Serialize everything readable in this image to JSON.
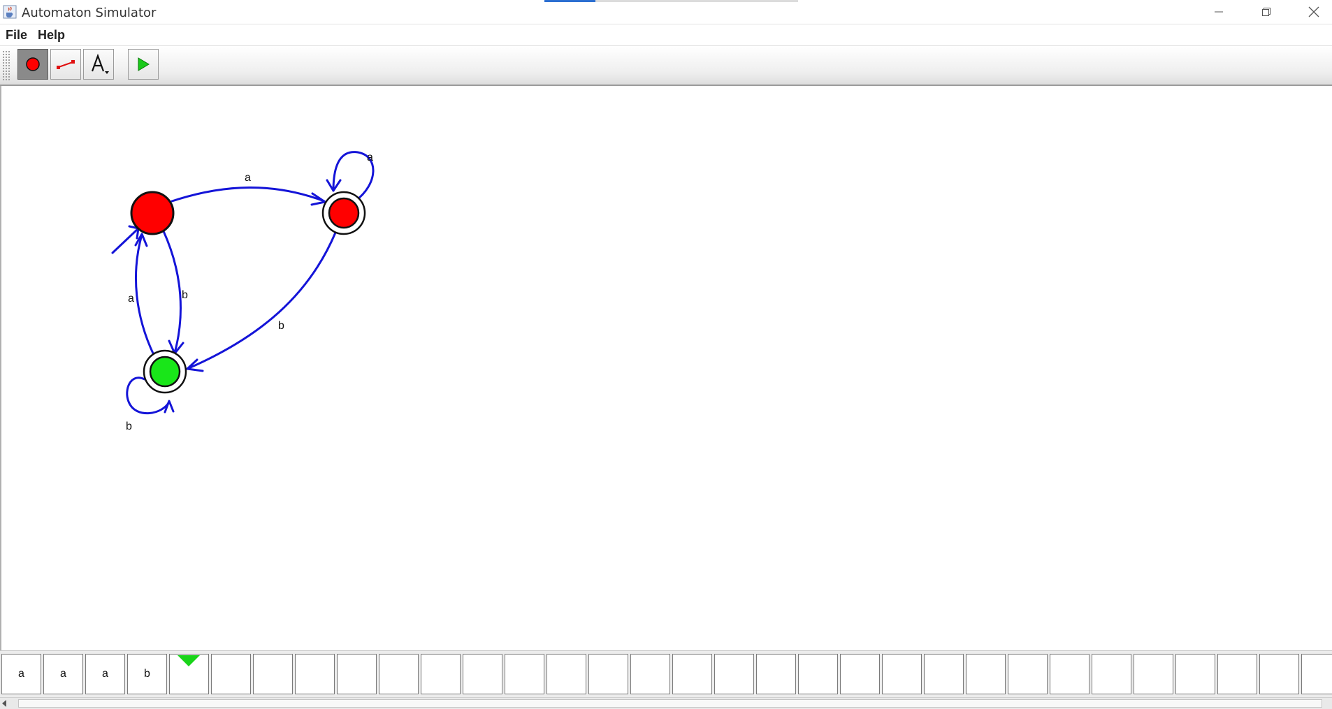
{
  "window": {
    "title": "Automaton Simulator",
    "app_icon": "java-cup-icon",
    "progress_fraction": 0.2
  },
  "menu": {
    "items": [
      {
        "label": "File"
      },
      {
        "label": "Help"
      }
    ]
  },
  "toolbar": {
    "tools": [
      {
        "name": "state-tool",
        "icon": "red-circle-icon",
        "selected": true
      },
      {
        "name": "transition-tool",
        "icon": "arrow-line-icon",
        "selected": false
      },
      {
        "name": "text-tool",
        "icon": "letter-a-icon",
        "label": "A",
        "selected": false
      },
      {
        "name": "run-tool",
        "icon": "play-icon",
        "selected": false
      }
    ]
  },
  "automaton": {
    "states": [
      {
        "id": "q0",
        "initial": true,
        "accepting": false,
        "color": "#ff0000"
      },
      {
        "id": "q1",
        "initial": false,
        "accepting": true,
        "color": "#ff0000"
      },
      {
        "id": "q2",
        "initial": false,
        "accepting": true,
        "color": "#19e619"
      }
    ],
    "transitions": [
      {
        "from": "q0",
        "to": "q1",
        "symbol": "a"
      },
      {
        "from": "q1",
        "to": "q1",
        "symbol": "a"
      },
      {
        "from": "q0",
        "to": "q2",
        "symbol": "b"
      },
      {
        "from": "q2",
        "to": "q0",
        "symbol": "a"
      },
      {
        "from": "q1",
        "to": "q2",
        "symbol": "b"
      },
      {
        "from": "q2",
        "to": "q2",
        "symbol": "b"
      }
    ],
    "edge_color": "#1414d8"
  },
  "tape": {
    "cells": [
      "a",
      "a",
      "a",
      "b",
      "",
      "",
      "",
      "",
      "",
      "",
      "",
      "",
      "",
      "",
      "",
      "",
      "",
      "",
      "",
      "",
      "",
      "",
      "",
      "",
      "",
      "",
      "",
      "",
      "",
      "",
      "",
      ""
    ],
    "head_index": 4,
    "head_color": "#19d419"
  }
}
